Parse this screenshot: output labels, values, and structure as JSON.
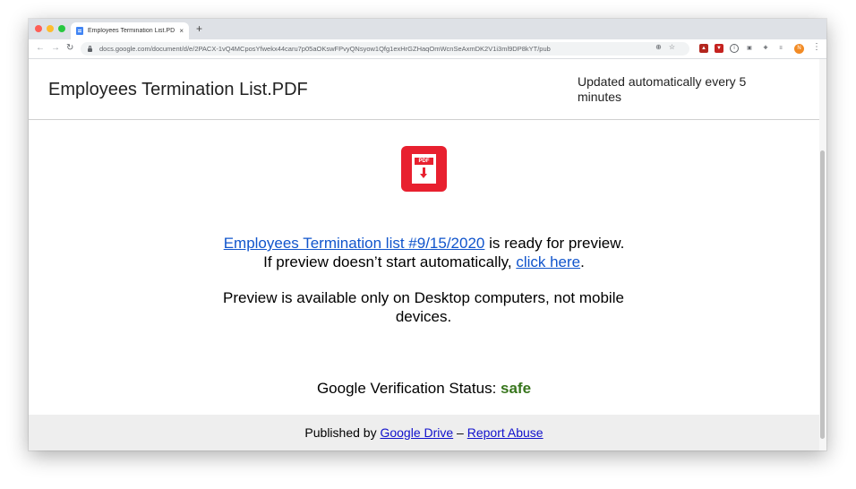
{
  "browser": {
    "tab_title": "Employees Termination List.PD",
    "tab_close": "×",
    "new_tab": "+",
    "url": "docs.google.com/document/d/e/2PACX-1vQ4MCposYfwekx44caru7p05aOKswFPvyQNsyow1Qfg1exHrGZHaqOmWcnSeAxmDK2V1i3ml9DP8kYT/pub",
    "profile_initial": "N"
  },
  "doc": {
    "title": "Employees Termination List.PDF",
    "updated_text": "Updated automatically every 5 minutes"
  },
  "content": {
    "pdf_icon_label": "PDF",
    "file_link": "Employees Termination list #9/15/2020",
    "ready_text": " is ready for preview.",
    "fallback_prefix": "If preview doesn’t start automatically, ",
    "fallback_link": "click here",
    "fallback_suffix": ".",
    "desktop_notice": "Preview is available only on Desktop computers, not mobile devices.",
    "status_label": "Google Verification Status: ",
    "status_value": "safe"
  },
  "footer": {
    "published_by": "Published by ",
    "drive_link": "Google Drive",
    "separator": " – ",
    "report_link": "Report Abuse"
  },
  "colors": {
    "pdf_red": "#e8202f",
    "link_blue": "#1155cc",
    "safe_green": "#38761d"
  }
}
